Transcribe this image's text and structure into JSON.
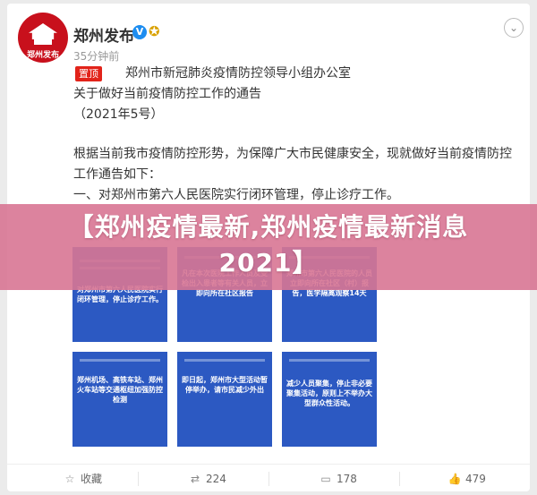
{
  "post": {
    "author": "郑州发布",
    "avatar_text": "郑州发布",
    "time": "35分钟前",
    "pin_label": "置顶",
    "lines": [
      "郑州市新冠肺炎疫情防控领导小组办公室",
      "关于做好当前疫情防控工作的通告",
      "（2021年5号）",
      "根据当前我市疫情防控形势，为保障广大市民健康安全，现就做好当前疫情防控",
      "工作通告如下：",
      "一、对郑州市第六人民医院实行闭环管理，停止诊疗工作。"
    ]
  },
  "headline": {
    "line1": "【郑州疫情最新,郑州疫情最新消息",
    "line2": "2021】"
  },
  "panels": [
    {
      "text": "对郑州市第六人民医院实行闭环管理，停止诊疗工作。"
    },
    {
      "text": "凡在本次医院工作人员及受检出入患者等有关人员，立即向所在社区报告"
    },
    {
      "text": "郑州市第六人民医院的人员立即向所在社区（村）报告，医学隔离观察14天"
    },
    {
      "text": "郑州机场、高铁车站、郑州火车站等交通枢纽加强防控检测"
    },
    {
      "text": "即日起，郑州市大型活动暂停举办，请市民减少外出"
    },
    {
      "text": "减少人员聚集，停止非必要聚集活动，原则上不举办大型群众性活动。"
    }
  ],
  "footer": {
    "share": "收藏",
    "repost": "224",
    "comment": "178",
    "like": "479"
  }
}
